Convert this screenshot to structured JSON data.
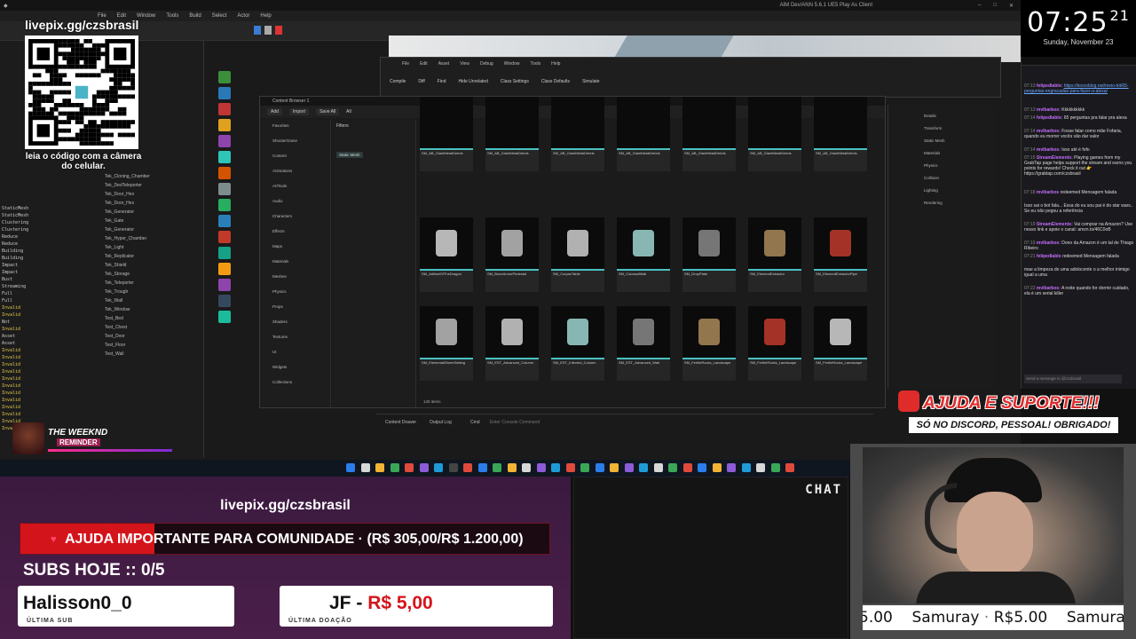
{
  "editor": {
    "window_title": "AIM Dev/ANN 5.6.1 UE5 Play As Client",
    "menu": [
      "File",
      "Edit",
      "Window",
      "Tools",
      "Build",
      "Select",
      "Actor",
      "Help"
    ],
    "blueprint_menu": [
      "File",
      "Edit",
      "Asset",
      "View",
      "Debug",
      "Window",
      "Tools",
      "Help"
    ],
    "blueprint_tools": [
      "Compile",
      "Diff",
      "Find",
      "Hide Unrelated",
      "Class Settings",
      "Class Defaults",
      "Simulate"
    ],
    "content_browser_title": "Content Browser 1",
    "cb_toolbar": [
      "Add",
      "Import",
      "Save All",
      "All"
    ],
    "sources": [
      "Favorites",
      "ShooterGame",
      "Content",
      "Animations",
      "ArtTools",
      "Audio",
      "Characters",
      "Effects",
      "Maps",
      "Materials",
      "Meshes",
      "Physics",
      "Props",
      "Shaders",
      "Textures",
      "UI",
      "Widgets",
      "Collections"
    ],
    "filters_title": "Filters",
    "filter_item": "Static Mesh",
    "cb_status": "140 items",
    "tiles_row1": [
      "SM_AB_GiantMetalDebris",
      "SM_AB_GiantMetalDebris",
      "SM_AB_GiantMetalDebris",
      "SM_AB_GiantMetalDebris",
      "SM_AB_GiantMetalDebris",
      "SM_AB_GiantMetalDebris",
      "SM_AB_GiantMetalDebris"
    ],
    "tiles_row2": [
      "SM_ArtifactOfTheDragon",
      "SM_BoneArmorPedestal",
      "SM_CorpseTable",
      "SM_ColossalWall",
      "SM_DropPlate",
      "SM_ElementExtractor",
      "SM_ElementExtractorPipe"
    ],
    "tiles_row3": [
      "SM_ElementalStoneSetting",
      "SM_EST_Advanced_Column",
      "SM_EST_Infected_Column",
      "SM_EST_Advanced_Wall",
      "SM_FertileRocks_Landscape",
      "SM_FertileRocks_Landscape",
      "SM_FertileRocks_Landscape"
    ],
    "output_tabs": [
      "Content Drawer",
      "Output Log",
      "Cmd"
    ],
    "cmd_placeholder": "Enter Console Command",
    "log_lines": [
      "StaticMesh",
      "StaticMesh",
      "Clustering",
      "Clustering",
      "Reduce",
      "Reduce",
      "Building",
      "Building",
      "Impact",
      "Impact",
      "Bust",
      "Streaming",
      "Full",
      "Full",
      "Invalid",
      "Invalid",
      "Not",
      "Invalid",
      "Asset",
      "Asset",
      "Invalid",
      "Invalid",
      "Invalid",
      "Invalid",
      "Invalid",
      "Invalid",
      "Invalid",
      "Invalid",
      "Invalid",
      "Invalid",
      "Invalid",
      "Invalid"
    ],
    "outliner_lines": [
      "Tek_Cloning_Chamber",
      "Tek_DedTeleporter",
      "Tek_Door_Hex",
      "Tek_Door_Hex",
      "Tek_Generator",
      "Tek_Gate",
      "Tek_Generator",
      "Tek_Hyper_Chamber",
      "Tek_Light",
      "Tek_Replicator",
      "Tek_Shield",
      "Tek_Storage",
      "Tek_Teleporter",
      "Tek_Trough",
      "Tek_Wall",
      "Tek_Window",
      "Test_Bed",
      "Test_Chest",
      "Test_Door",
      "Test_Floor",
      "Test_Wall"
    ],
    "details_lines": [
      "Details",
      "Transform",
      "Static Mesh",
      "Materials",
      "Physics",
      "Collision",
      "Lighting",
      "Rendering"
    ]
  },
  "qr": {
    "url": "livepix.gg/czsbrasil",
    "caption": "leia o código com a câmera do celular."
  },
  "reminder": {
    "title": "THE WEEKND",
    "sub": "REMINDER"
  },
  "clock": {
    "time": "07:25",
    "seconds": "21",
    "date": "Sunday, November 23"
  },
  "chat": {
    "messages": [
      {
        "time": "07:13",
        "user": "felipedlablo:",
        "text": "https://tecnoblog.net/meio-bit/65-perguntas-engracadas-para-fazer-a-alexa/"
      },
      {
        "time": "07:13",
        "user": "mvlbarbos:",
        "text": "Kkkkkkkkkk"
      },
      {
        "time": "07:14",
        "user": "felipedlablo:",
        "text": "65 perguntas pra falar pra alexa"
      },
      {
        "time": "07:14",
        "user": "mvlbarbos:",
        "text": "Fosse falar como mãe Fofaria, quando eu morrer vocês vão dar valor"
      },
      {
        "time": "07:14",
        "user": "mvlbarbos:",
        "text": "Isso até é fofo"
      },
      {
        "time": "07:15",
        "user": "StreamElements:",
        "text": "Playing games from my GrabTap page helps support the stream and earns you points for rewards! Check it out 👉 https://grabtap.com/czsbrasil"
      },
      {
        "time": "07:18",
        "user": "mvlbarbos",
        "text": "redeemed Mensagem falada"
      },
      {
        "time": "",
        "user": "",
        "text": "Isso sai o bot fala... Essa do eu sou pai é do star wars.. Se eu não pegou a referência"
      },
      {
        "time": "07:19",
        "user": "StreamElements:",
        "text": "Vai comprar na Amazon? Use nosso link e apoie o canal: amzn.to/46C0oB"
      },
      {
        "time": "07:19",
        "user": "mvlbarbos:",
        "text": "Dono da Amazon é um tal de Thiago Ribeiro"
      },
      {
        "time": "07:21",
        "user": "felipedlablo",
        "text": "redeemed Mensagem falada"
      },
      {
        "time": "",
        "user": "",
        "text": "mae a limpeza do uma adolocente o a melhor inimigo igual a uma"
      },
      {
        "time": "07:22",
        "user": "mvlbarbos:",
        "text": "A noite quando for dormir cuidado, ela é um serial killer"
      }
    ],
    "input_placeholder": "Send a message to @czsbrasil"
  },
  "ajuda": {
    "title": "AJUDA E SUPORTE!!!",
    "sub": "SÓ NO DISCORD, PESSOAL! OBRIGADO!"
  },
  "bottom": {
    "pix_url": "livepix.gg/czsbrasil",
    "goal_text": "AJUDA IMPORTANTE PARA COMUNIDADE · (R$ 305,00/R$ 1.200,00)",
    "goal_progress": 0.254,
    "subs_hoje": "SUBS HOJE :: 0/5",
    "last_sub_name": "Halisson0_0",
    "last_sub_label": "ÚLTIMA SUB",
    "last_donation_name": "JF -",
    "last_donation_amount": "R$ 5,00",
    "last_donation_label": "ÚLTIMA DOAÇÃO",
    "chat_label": "CHAT",
    "ticker": [
      "5.00",
      "Samuray",
      "R$5.00",
      "Samura"
    ]
  },
  "colors": {
    "accent_red": "#d4141b",
    "chat_user": "#c46cff",
    "tile_bar": "#4ac1c1"
  }
}
